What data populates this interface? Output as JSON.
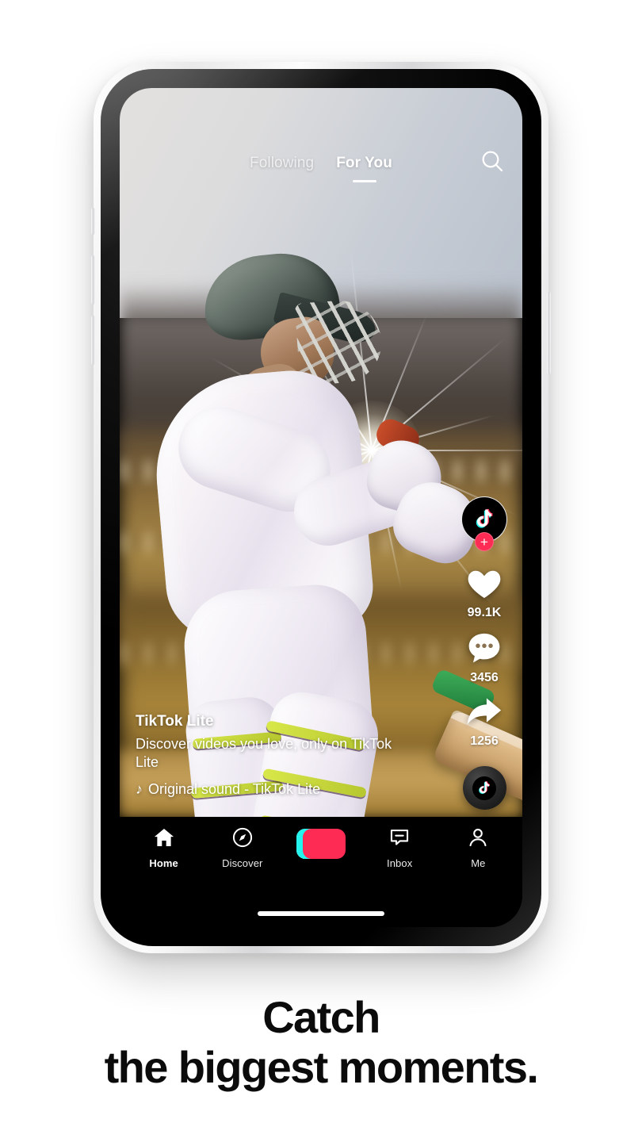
{
  "app": {
    "name": "TikTok Lite",
    "accent_pink": "#fe2c55",
    "accent_cyan": "#25f4ee",
    "nav_background": "#000000"
  },
  "topbar": {
    "tabs": [
      {
        "label": "Following",
        "active": false
      },
      {
        "label": "For You",
        "active": true
      }
    ],
    "search_icon": "search-icon"
  },
  "video": {
    "caption": {
      "username": "TikTok Lite",
      "description": "Discover videos you love, only on TikTok Lite",
      "sound_icon": "music-note-icon",
      "sound": "Original sound - TikTok Lite"
    },
    "actions": {
      "avatar": {
        "icon": "tiktok-logo-icon",
        "follow_badge": "+"
      },
      "like": {
        "icon": "heart-icon",
        "count": "99.1K"
      },
      "comment": {
        "icon": "comment-icon",
        "count": "3456"
      },
      "share": {
        "icon": "share-arrow-icon",
        "count": "1256"
      },
      "music_disc": {
        "icon": "tiktok-note-icon"
      }
    }
  },
  "bottom_nav": {
    "items": [
      {
        "label": "Home",
        "icon": "home-icon",
        "active": true
      },
      {
        "label": "Discover",
        "icon": "compass-icon",
        "active": false
      },
      {
        "label": "",
        "icon": "create-plus-icon",
        "active": false
      },
      {
        "label": "Inbox",
        "icon": "inbox-message-icon",
        "active": false
      },
      {
        "label": "Me",
        "icon": "person-icon",
        "active": false
      }
    ],
    "create_symbol": "+"
  },
  "promo": {
    "line1": "Catch",
    "line2": "the biggest moments."
  }
}
